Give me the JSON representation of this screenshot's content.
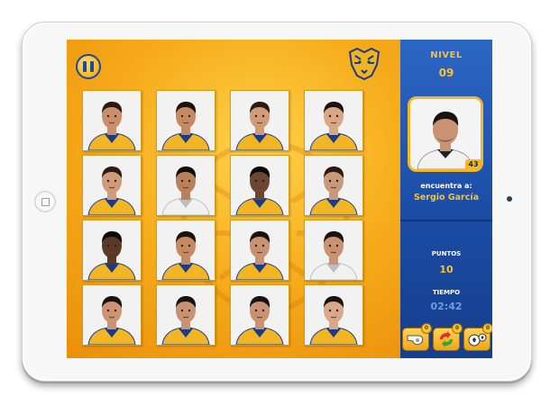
{
  "hud": {
    "level_label": "NIVEL",
    "level_value": "09",
    "find_label": "encuentra a:",
    "target_name": "Sergio García",
    "target_badge": "43",
    "points_label": "PUNTOS",
    "points_value": "10",
    "time_label": "TIEMPO",
    "time_value": "02:42"
  },
  "powerups": [
    {
      "name": "whistle",
      "count": "0"
    },
    {
      "name": "shuffle",
      "count": "0"
    },
    {
      "name": "reveal",
      "count": "0"
    }
  ],
  "cards": [
    {
      "skin": "#c98f6a",
      "hair": "#2a1a10",
      "kit": "gold"
    },
    {
      "skin": "#c58a62",
      "hair": "#1a120c",
      "kit": "gold"
    },
    {
      "skin": "#d09b76",
      "hair": "#2a1a10",
      "kit": "gold"
    },
    {
      "skin": "#d9a784",
      "hair": "#1a120c",
      "kit": "gold"
    },
    {
      "skin": "#cf9b78",
      "hair": "#2b1b10",
      "kit": "gold"
    },
    {
      "skin": "#b98159",
      "hair": "#120c08",
      "kit": "white"
    },
    {
      "skin": "#6b4630",
      "hair": "#0c0806",
      "kit": "gold"
    },
    {
      "skin": "#c99a7a",
      "hair": "#2a1a10",
      "kit": "gold"
    },
    {
      "skin": "#5a3a26",
      "hair": "#0c0806",
      "kit": "gold"
    },
    {
      "skin": "#c58a62",
      "hair": "#1a120c",
      "kit": "gold"
    },
    {
      "skin": "#c99272",
      "hair": "#1a120c",
      "kit": "gold"
    },
    {
      "skin": "#c99272",
      "hair": "#1a120c",
      "kit": "white"
    },
    {
      "skin": "#cc9474",
      "hair": "#1a120c",
      "kit": "gold"
    },
    {
      "skin": "#c99272",
      "hair": "#1a120c",
      "kit": "gold"
    },
    {
      "skin": "#c99272",
      "hair": "#1a120c",
      "kit": "gold"
    },
    {
      "skin": "#d8a888",
      "hair": "#1a120c",
      "kit": "gold"
    }
  ],
  "colors": {
    "panel_blue": "#1a4aa2",
    "accent_gold": "#f7c233",
    "background_orange": "#f6ac1a"
  }
}
